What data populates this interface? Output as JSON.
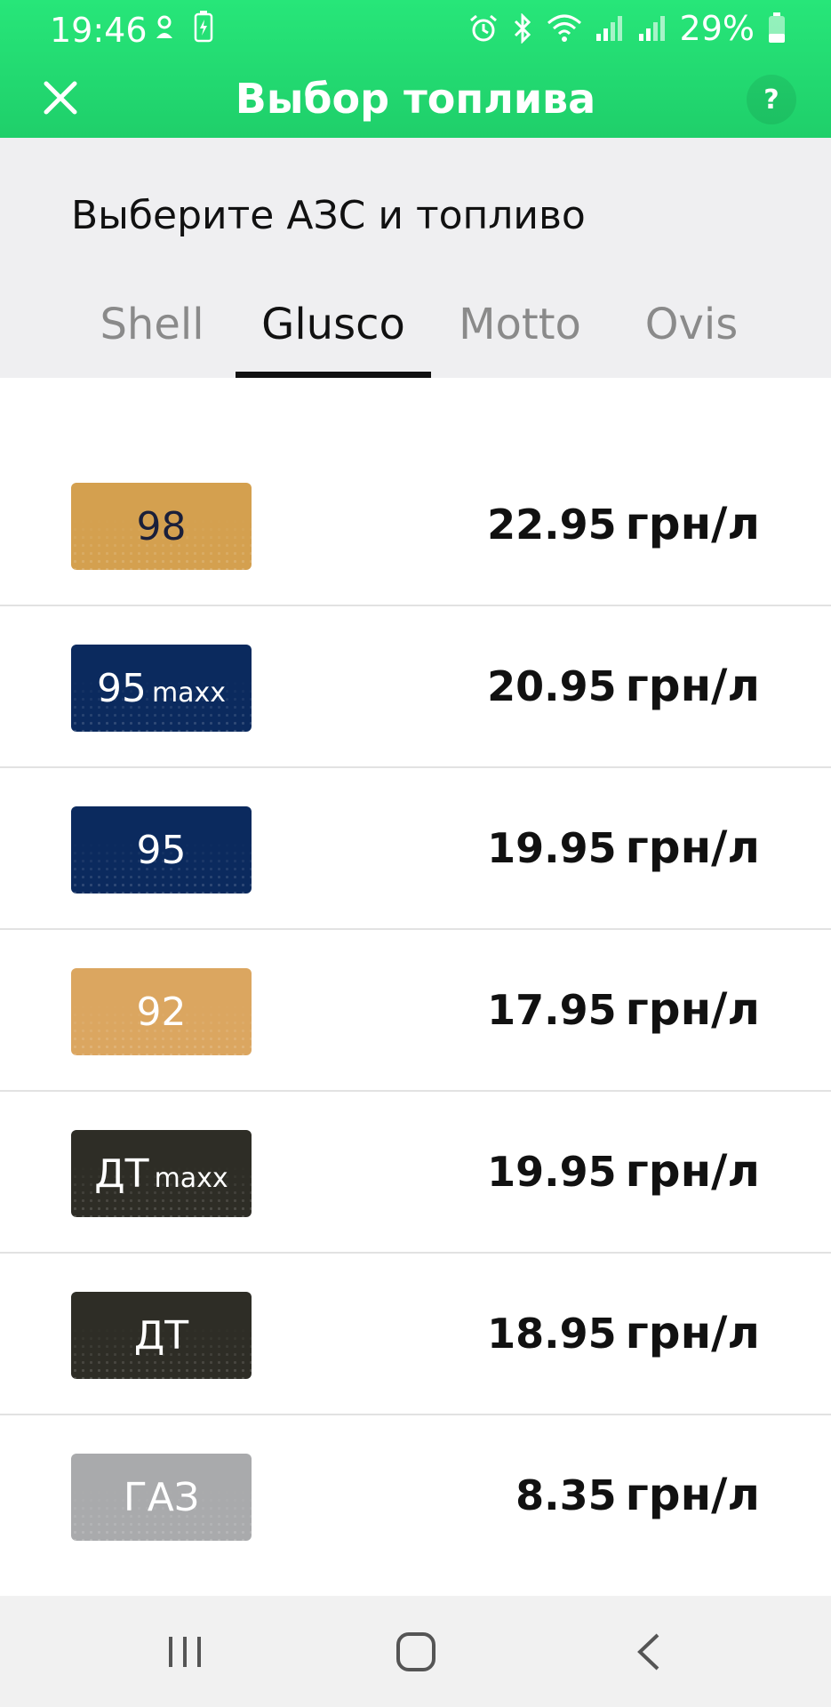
{
  "status_bar": {
    "time": "19:46",
    "battery_percent": "29%"
  },
  "toolbar": {
    "title": "Выбор топлива",
    "help_label": "?"
  },
  "subtitle": "Выберите АЗС и топливо",
  "tabs": [
    {
      "label": "Shell",
      "active": false
    },
    {
      "label": "Glusco",
      "active": true
    },
    {
      "label": "Motto",
      "active": false
    },
    {
      "label": "Ovis",
      "active": false
    }
  ],
  "fuels": [
    {
      "badge": "98",
      "badge_suffix": "",
      "badge_color": "#d4a04f",
      "text_color": "#1a1f3a",
      "price": "22.95",
      "unit": "грн/л"
    },
    {
      "badge": "95",
      "badge_suffix": "maxx",
      "badge_color": "#0b2a5e",
      "text_color": "#ffffff",
      "price": "20.95",
      "unit": "грн/л"
    },
    {
      "badge": "95",
      "badge_suffix": "",
      "badge_color": "#0b2a5e",
      "text_color": "#ffffff",
      "price": "19.95",
      "unit": "грн/л"
    },
    {
      "badge": "92",
      "badge_suffix": "",
      "badge_color": "#dba660",
      "text_color": "#ffffff",
      "price": "17.95",
      "unit": "грн/л"
    },
    {
      "badge": "ДТ",
      "badge_suffix": "maxx",
      "badge_color": "#2e2d26",
      "text_color": "#ffffff",
      "price": "19.95",
      "unit": "грн/л"
    },
    {
      "badge": "ДТ",
      "badge_suffix": "",
      "badge_color": "#2e2d26",
      "text_color": "#ffffff",
      "price": "18.95",
      "unit": "грн/л"
    },
    {
      "badge": "ГАЗ",
      "badge_suffix": "",
      "badge_color": "#a9aaac",
      "text_color": "#ffffff",
      "price": "8.35",
      "unit": "грн/л"
    }
  ],
  "colors": {
    "header_green": "#22d872",
    "subheader_bg": "#efeff1",
    "nav_bg": "#f1f1f1"
  },
  "nav_icons": [
    "recent-apps-icon",
    "home-icon",
    "back-icon"
  ]
}
